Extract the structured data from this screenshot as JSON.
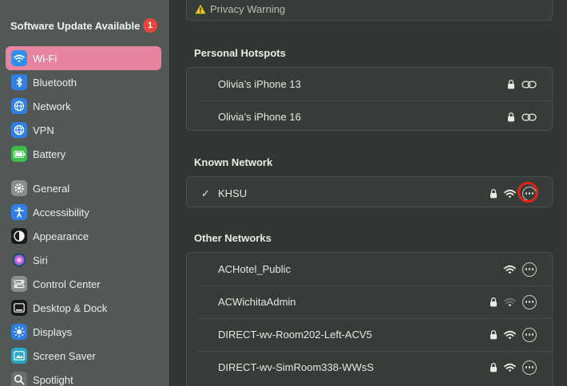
{
  "sidebar": {
    "software_update": {
      "label": "Software Update Available",
      "badge": "1"
    },
    "items": [
      {
        "label": "Wi-Fi",
        "icon": "wifi-icon",
        "color": "#2f8ff0",
        "active": true
      },
      {
        "label": "Bluetooth",
        "icon": "bluetooth-icon",
        "color": "#2f7fe8"
      },
      {
        "label": "Network",
        "icon": "globe-icon",
        "color": "#2f7fe8"
      },
      {
        "label": "VPN",
        "icon": "vpn-icon",
        "color": "#2f7fe8"
      },
      {
        "label": "Battery",
        "icon": "battery-icon",
        "color": "#3bbf4a"
      },
      {
        "label": "General",
        "icon": "gear-icon",
        "color": "#8a8f8c"
      },
      {
        "label": "Accessibility",
        "icon": "accessibility-icon",
        "color": "#2f7fe8"
      },
      {
        "label": "Appearance",
        "icon": "appearance-icon",
        "color": "#1a1a1a"
      },
      {
        "label": "Siri",
        "icon": "siri-icon",
        "color": "#6a3fd0"
      },
      {
        "label": "Control Center",
        "icon": "control-center-icon",
        "color": "#8a8f8c"
      },
      {
        "label": "Desktop & Dock",
        "icon": "dock-icon",
        "color": "#1a1a1a"
      },
      {
        "label": "Displays",
        "icon": "displays-icon",
        "color": "#2f7fe8"
      },
      {
        "label": "Screen Saver",
        "icon": "screen-saver-icon",
        "color": "#2aa6c7"
      },
      {
        "label": "Spotlight",
        "icon": "spotlight-icon",
        "color": "#6a6f6c"
      }
    ]
  },
  "main": {
    "privacy_warning": {
      "icon": "warning-icon",
      "text": "Privacy Warning"
    },
    "personal_hotspots": {
      "title": "Personal Hotspots",
      "networks": [
        {
          "name": "Olivia’s iPhone 13",
          "icons": [
            "lock-icon",
            "link-icon"
          ]
        },
        {
          "name": "Olivia’s iPhone 16",
          "icons": [
            "lock-icon",
            "link-icon"
          ]
        }
      ]
    },
    "known_network": {
      "title": "Known Network",
      "networks": [
        {
          "check": "✓",
          "name": "KHSU",
          "icons": [
            "lock-icon",
            "wifi-icon",
            "more-icon"
          ],
          "highlight_color": "#e5231a"
        }
      ]
    },
    "other_networks": {
      "title": "Other Networks",
      "networks": [
        {
          "name": "ACHotel_Public",
          "icons": [
            "wifi-icon",
            "more-icon"
          ]
        },
        {
          "name": "ACWichitaAdmin",
          "icons": [
            "lock-icon",
            "wifi-weak-icon",
            "more-icon"
          ]
        },
        {
          "name": "DIRECT-wv-Room202-Left-ACV5",
          "icons": [
            "lock-icon",
            "wifi-icon",
            "more-icon"
          ]
        },
        {
          "name": "DIRECT-wv-SimRoom338-WWsS",
          "icons": [
            "lock-icon",
            "wifi-icon",
            "more-icon"
          ]
        }
      ]
    }
  }
}
